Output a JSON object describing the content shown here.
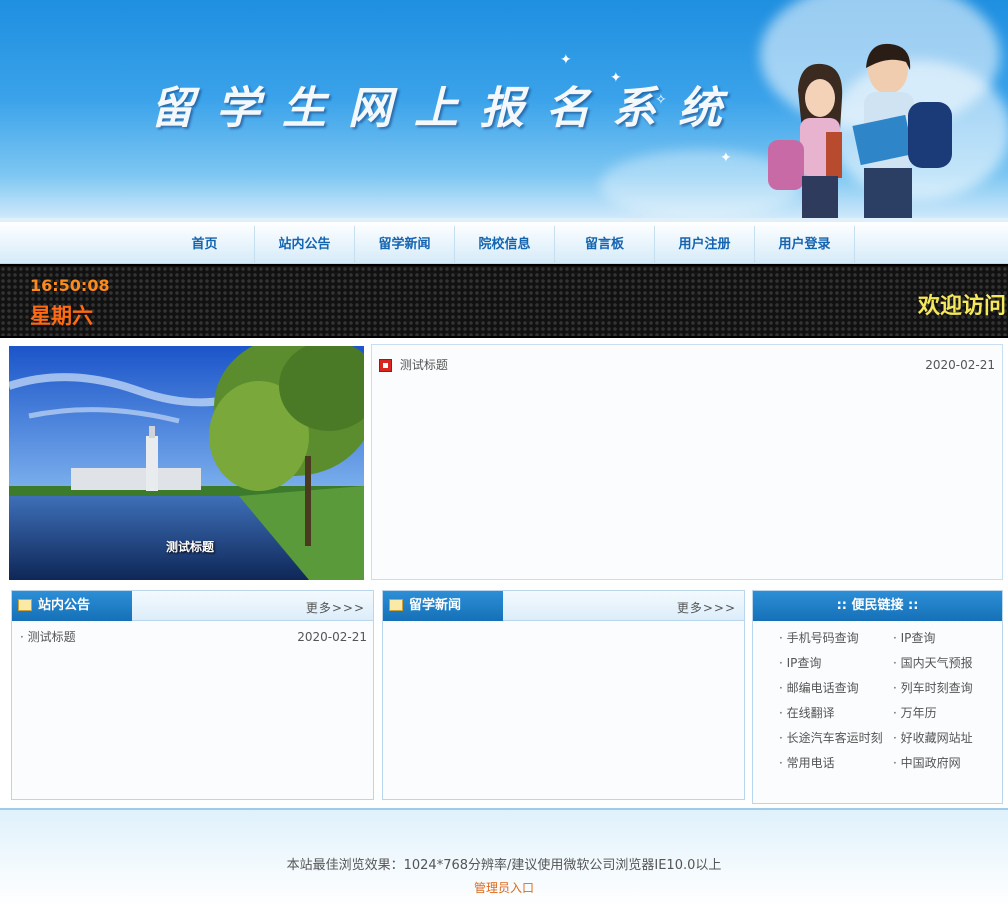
{
  "header": {
    "title": "留学生网上报名系统"
  },
  "nav": {
    "items": [
      "首页",
      "站内公告",
      "留学新闻",
      "院校信息",
      "留言板",
      "用户注册",
      "用户登录"
    ]
  },
  "ticker": {
    "time": "16:50:08",
    "weekday": "星期六",
    "welcome": "欢迎访问"
  },
  "featured": {
    "caption": "测试标题"
  },
  "news_list": [
    {
      "title": "测试标题",
      "date": "2020-02-21"
    }
  ],
  "notice_panel": {
    "title": "站内公告",
    "more": "更多>>>",
    "items": [
      {
        "title": "测试标题",
        "date": "2020-02-21"
      }
    ]
  },
  "study_news_panel": {
    "title": "留学新闻",
    "more": "更多>>>"
  },
  "links_panel": {
    "title": ":: 便民链接 ::",
    "items": [
      "手机号码查询",
      "IP查询",
      "IP查询",
      "国内天气预报",
      "邮编电话查询",
      "列车时刻查询",
      "在线翻译",
      "万年历",
      "长途汽车客运时刻",
      "好收藏网站址",
      "常用电话",
      "中国政府网"
    ]
  },
  "footer": {
    "note": "本站最佳浏览效果：1024*768分辨率/建议使用微软公司浏览器IE10.0以上",
    "admin": "管理员入口"
  }
}
